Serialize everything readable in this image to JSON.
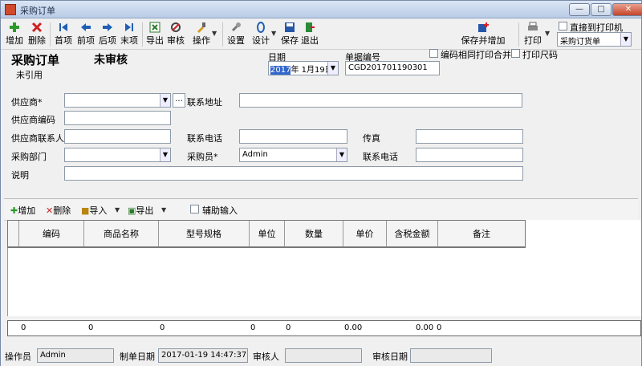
{
  "window": {
    "title": "采购订单",
    "min": "—",
    "max": "□",
    "close": "✕"
  },
  "toolbar": {
    "add": "增加",
    "delete": "删除",
    "first": "首项",
    "prev": "前项",
    "next": "后项",
    "last": "末项",
    "export": "导出",
    "audit": "审核",
    "operate": "操作",
    "settings": "设置",
    "design": "设计",
    "save": "保存",
    "exit": "退出",
    "save_add": "保存并增加",
    "print": "打印",
    "direct_print": "直接到打印机",
    "print_template": "采购订货单"
  },
  "header": {
    "title": "采购订单",
    "status": "未审核",
    "reference": "未引用",
    "date_label": "日期",
    "date_year": "2017",
    "date_rest": "年 1月19日",
    "doc_no_label": "单据编号",
    "doc_no": "CGD201701190301",
    "merge_print": "编码相同打印合并",
    "print_size": "打印尺码"
  },
  "form": {
    "supplier_label": "供应商*",
    "supplier_value": "",
    "supplier_more": "...",
    "address_label": "联系地址",
    "address_value": "",
    "supplier_code_label": "供应商编码",
    "supplier_code_value": "",
    "contact_label": "供应商联系人",
    "contact_value": "",
    "phone_label": "联系电话",
    "phone_value": "",
    "fax_label": "传真",
    "fax_value": "",
    "dept_label": "采购部门",
    "dept_value": "",
    "buyer_label": "采购员*",
    "buyer_value": "Admin",
    "phone2_label": "联系电话",
    "phone2_value": "",
    "note_label": "说明",
    "note_value": ""
  },
  "grid_toolbar": {
    "add": "增加",
    "delete": "删除",
    "import": "导入",
    "export": "导出",
    "assist": "辅助输入"
  },
  "grid": {
    "columns": [
      "编码",
      "商品名称",
      "型号规格",
      "单位",
      "数量",
      "单价",
      "含税金额",
      "备注"
    ],
    "totals": [
      "0",
      "0",
      "0",
      "0",
      "0",
      "0.00",
      "0.00",
      "0"
    ]
  },
  "footer": {
    "operator_label": "操作员",
    "operator_value": "Admin",
    "created_label": "制单日期",
    "created_value": "2017-01-19 14:47:37",
    "auditor_label": "审核人",
    "auditor_value": "",
    "audit_date_label": "审核日期",
    "audit_date_value": ""
  },
  "colors": {
    "accent": "#1e5fb4",
    "title_bar": "#c8d8ee"
  }
}
